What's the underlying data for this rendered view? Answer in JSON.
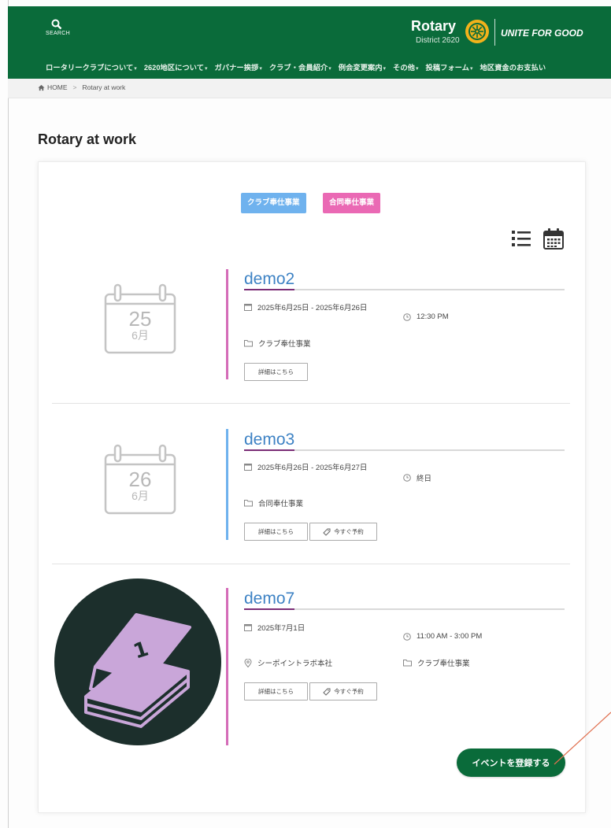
{
  "header": {
    "search_label": "SEARCH",
    "brand_name": "Rotary",
    "district": "District 2620",
    "tagline": "UNITE FOR GOOD",
    "bg_color": "#0a6b3a",
    "nav": [
      {
        "label": "ロータリークラブについて"
      },
      {
        "label": "2620地区について"
      },
      {
        "label": "ガバナー挨拶"
      },
      {
        "label": "クラブ・会員紹介"
      },
      {
        "label": "例会変更案内"
      },
      {
        "label": "その他"
      },
      {
        "label": "投稿フォーム"
      },
      {
        "label": "地区資金のお支払い"
      }
    ]
  },
  "breadcrumb": {
    "home": "HOME",
    "separator": ">",
    "current": "Rotary at work"
  },
  "page_title": "Rotary at work",
  "filters": [
    {
      "label": "クラブ奉仕事業",
      "color": "#6fb2ee"
    },
    {
      "label": "合同奉仕事業",
      "color": "#ea69b4"
    }
  ],
  "view_icons": {
    "list": "list-view-icon",
    "calendar": "calendar-view-icon"
  },
  "events": [
    {
      "title": "demo2",
      "date_range": "2025年6月25日 - 2025年6月26日",
      "time": "12:30 PM",
      "category": "クラブ奉仕事業",
      "day": "25",
      "month": "6月",
      "details_label": "詳細はこちら",
      "bar_color": "#d46cb8"
    },
    {
      "title": "demo3",
      "date_range": "2025年6月26日 - 2025年6月27日",
      "time": "終日",
      "category": "合同奉仕事業",
      "day": "26",
      "month": "6月",
      "details_label": "詳細はこちら",
      "book_label": "今すぐ予約",
      "bar_color": "#6fb2ee"
    },
    {
      "title": "demo7",
      "date": "2025年7月1日",
      "time": "11:00 AM - 3:00 PM",
      "location": "シーポイントラボ本社",
      "category": "クラブ奉仕事業",
      "details_label": "詳細はこちら",
      "book_label": "今すぐ予約",
      "bar_color": "#d46cb8"
    }
  ],
  "register_button": "イベントを登録する",
  "annotation_color": "#e07050"
}
